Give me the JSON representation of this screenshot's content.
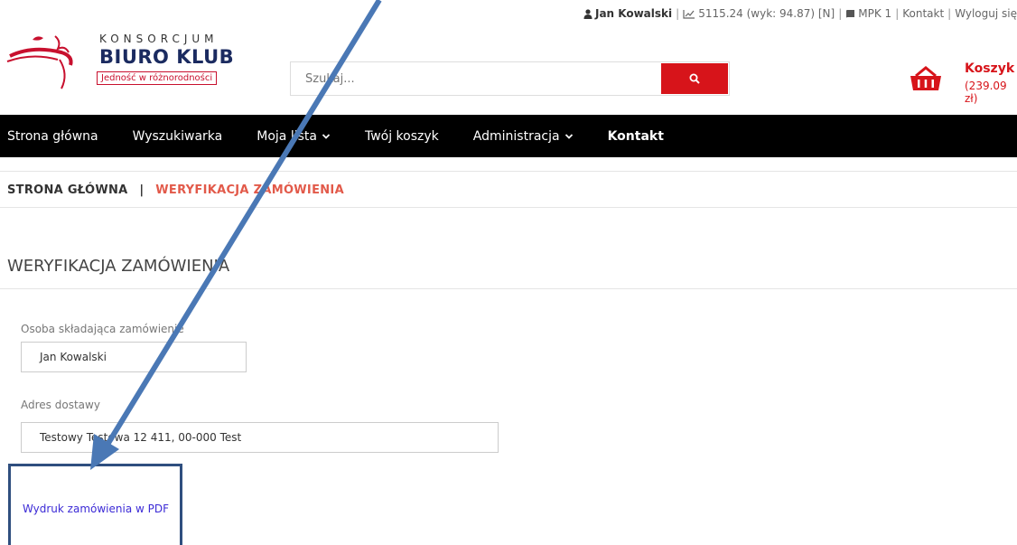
{
  "topbar": {
    "user": "Jan Kowalski",
    "stats": "5115.24 (wyk: 94.87) [N]",
    "mpk": "MPK 1",
    "contact": "Kontakt",
    "logout": "Wyloguj się"
  },
  "logo": {
    "line1": "KONSORCJUM",
    "line2": "BIURO KLUB",
    "line3": "Jedność w różnorodności"
  },
  "search": {
    "placeholder": "Szukaj..."
  },
  "cart": {
    "label": "Koszyk",
    "total": "(239.09 zł)"
  },
  "nav": {
    "items": [
      {
        "label": "Strona główna",
        "dropdown": false
      },
      {
        "label": "Wyszukiwarka",
        "dropdown": false
      },
      {
        "label": "Moja lista",
        "dropdown": true
      },
      {
        "label": "Twój koszyk",
        "dropdown": false
      },
      {
        "label": "Administracja",
        "dropdown": true
      },
      {
        "label": "Kontakt",
        "dropdown": false
      }
    ]
  },
  "breadcrumb": {
    "home": "STRONA GŁÓWNA",
    "separator": "|",
    "current": "WERYFIKACJA ZAMÓWIENIA"
  },
  "page": {
    "title": "WERYFIKACJA ZAMÓWIENIA",
    "orderer_label": "Osoba składająca zamówienie",
    "orderer_value": "Jan Kowalski",
    "address_label": "Adres dostawy",
    "address_value": "Testowy Testowa 12 411, 00-000 Test",
    "pdf_link": "Wydruk zamówienia w PDF"
  },
  "colors": {
    "accent": "#d7141a",
    "nav_bg": "#000000",
    "breadcrumb_current": "#e25a4a",
    "annotation": "#4a78b5"
  }
}
